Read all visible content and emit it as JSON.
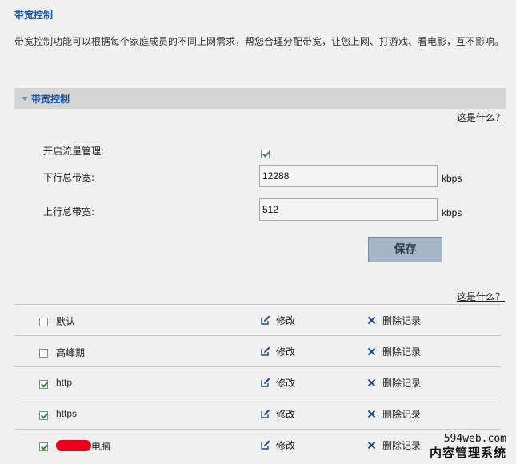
{
  "page": {
    "title": "带宽控制",
    "description": "带宽控制功能可以根据每个家庭成员的不同上网需求，帮您合理分配带宽，让您上网、打游戏、看电影，互不影响。"
  },
  "section": {
    "title": "带宽控制",
    "help_link": "这是什么？"
  },
  "settings": {
    "enable_label": "开启流量管理:",
    "enable_checked": true,
    "downlink_label": "下行总带宽:",
    "downlink_value": "12288",
    "uplink_label": "上行总带宽:",
    "uplink_value": "512",
    "unit": "kbps",
    "save_label": "保存"
  },
  "rules": {
    "help_link": "这是什么？",
    "edit_label": "修改",
    "delete_label": "删除记录",
    "items": [
      {
        "name": "默认",
        "checked": false
      },
      {
        "name": "高峰期",
        "checked": false
      },
      {
        "name": "http",
        "checked": true
      },
      {
        "name": "https",
        "checked": true
      },
      {
        "name": "电脑",
        "checked": true,
        "redacted_prefix": true
      }
    ]
  },
  "watermark": {
    "site": "594web.com",
    "text": "内容管理系统"
  },
  "colors": {
    "background": "#f0f0f0",
    "title_blue": "#1e5ca8",
    "section_bar": "#d5d5d5",
    "save_button": "#a6b6c6",
    "check_green": "#2a8a2a",
    "edit_icon_blue": "#1e4a8a",
    "delete_icon_blue": "#1e4a8a"
  },
  "icons": {
    "collapse": "triangle-down-icon",
    "edit": "pencil-square-icon",
    "delete": "x-icon"
  }
}
